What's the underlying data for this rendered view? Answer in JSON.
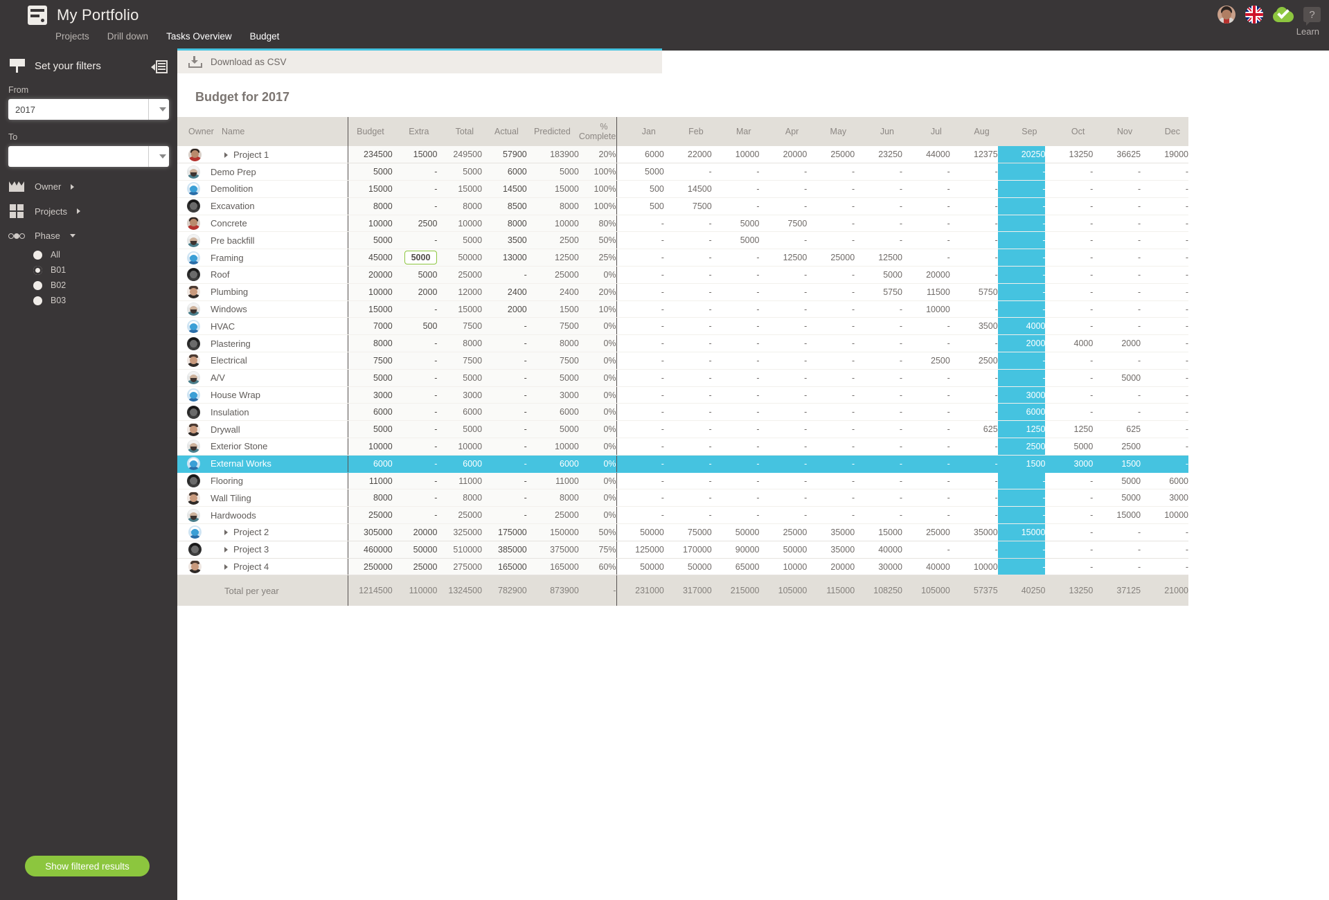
{
  "topbar": {
    "app_title": "My Portfolio",
    "nav": [
      {
        "label": "Projects",
        "active": false
      },
      {
        "label": "Drill down",
        "active": false
      },
      {
        "label": "Tasks Overview",
        "active": true
      },
      {
        "label": "Budget",
        "active": true
      }
    ],
    "learn_label": "Learn",
    "icons": [
      "user-avatar",
      "uk-flag-icon",
      "cloud-saved-icon",
      "help-icon"
    ]
  },
  "sidebar": {
    "title": "Set your filters",
    "from_label": "From",
    "from_value": "2017",
    "to_label": "To",
    "to_value": "",
    "groups": [
      {
        "label": "Owner",
        "icon": "crown-icon"
      },
      {
        "label": "Projects",
        "icon": "grid-icon"
      },
      {
        "label": "Phase",
        "icon": "phase-icon"
      }
    ],
    "phase_options": [
      {
        "label": "All",
        "selected": false
      },
      {
        "label": "B01",
        "selected": true
      },
      {
        "label": "B02",
        "selected": false
      },
      {
        "label": "B03",
        "selected": false
      }
    ],
    "show_button": "Show filtered results"
  },
  "main": {
    "csv_label": "Download as CSV",
    "page_title": "Budget for 2017",
    "headers": {
      "owner": "Owner",
      "name": "Name",
      "budget": "Budget",
      "extra": "Extra",
      "total": "Total",
      "actual": "Actual",
      "predicted": "Predicted",
      "percent_complete": "% Complete",
      "months": [
        "Jan",
        "Feb",
        "Mar",
        "Apr",
        "May",
        "Jun",
        "Jul",
        "Aug",
        "Sep",
        "Oct",
        "Nov",
        "Dec"
      ]
    },
    "highlight_month": "Sep",
    "highlight_color": "#45c3e0",
    "rows": [
      {
        "name": "Project 1",
        "type": "project",
        "expanded": true,
        "avatar": "a",
        "budget": "234500",
        "extra": "15000",
        "total": "249500",
        "actual": "57900",
        "predicted": "183900",
        "pct": "20%",
        "months": [
          "6000",
          "22000",
          "10000",
          "20000",
          "25000",
          "23250",
          "44000",
          "12375",
          "20250",
          "13250",
          "36625",
          "19000"
        ]
      },
      {
        "name": "Demo Prep",
        "type": "task",
        "avatar": "b",
        "budget": "5000",
        "extra": "-",
        "total": "5000",
        "actual": "6000",
        "predicted": "5000",
        "pct": "100%",
        "months": [
          "5000",
          "-",
          "-",
          "-",
          "-",
          "-",
          "-",
          "-",
          "-",
          "-",
          "-",
          "-"
        ]
      },
      {
        "name": "Demolition",
        "type": "task",
        "avatar": "c",
        "budget": "15000",
        "extra": "-",
        "total": "15000",
        "actual": "14500",
        "predicted": "15000",
        "pct": "100%",
        "months": [
          "500",
          "14500",
          "-",
          "-",
          "-",
          "-",
          "-",
          "-",
          "-",
          "-",
          "-",
          "-"
        ]
      },
      {
        "name": "Excavation",
        "type": "task",
        "avatar": "d",
        "budget": "8000",
        "extra": "-",
        "total": "8000",
        "actual": "8500",
        "predicted": "8000",
        "pct": "100%",
        "months": [
          "500",
          "7500",
          "-",
          "-",
          "-",
          "-",
          "-",
          "-",
          "-",
          "-",
          "-",
          "-"
        ]
      },
      {
        "name": "Concrete",
        "type": "task",
        "avatar": "a",
        "budget": "10000",
        "extra": "2500",
        "total": "10000",
        "actual": "8000",
        "predicted": "10000",
        "pct": "80%",
        "months": [
          "-",
          "-",
          "5000",
          "7500",
          "-",
          "-",
          "-",
          "-",
          "-",
          "-",
          "-",
          "-"
        ]
      },
      {
        "name": "Pre backfill",
        "type": "task",
        "avatar": "b",
        "budget": "5000",
        "extra": "-",
        "total": "5000",
        "actual": "3500",
        "predicted": "2500",
        "pct": "50%",
        "months": [
          "-",
          "-",
          "5000",
          "-",
          "-",
          "-",
          "-",
          "-",
          "-",
          "-",
          "-",
          "-"
        ]
      },
      {
        "name": "Framing",
        "type": "task",
        "avatar": "c",
        "budget": "45000",
        "extra": "5000",
        "extra_editing": true,
        "total": "50000",
        "actual": "13000",
        "predicted": "12500",
        "pct": "25%",
        "months": [
          "-",
          "-",
          "-",
          "12500",
          "25000",
          "12500",
          "-",
          "-",
          "-",
          "-",
          "-",
          "-"
        ]
      },
      {
        "name": "Roof",
        "type": "task",
        "avatar": "d",
        "budget": "20000",
        "extra": "5000",
        "total": "25000",
        "actual": "-",
        "predicted": "25000",
        "pct": "0%",
        "months": [
          "-",
          "-",
          "-",
          "-",
          "-",
          "5000",
          "20000",
          "-",
          "-",
          "-",
          "-",
          "-"
        ]
      },
      {
        "name": "Plumbing",
        "type": "task",
        "avatar": "e",
        "budget": "10000",
        "extra": "2000",
        "total": "12000",
        "actual": "2400",
        "predicted": "2400",
        "pct": "20%",
        "months": [
          "-",
          "-",
          "-",
          "-",
          "-",
          "5750",
          "11500",
          "5750",
          "-",
          "-",
          "-",
          "-"
        ]
      },
      {
        "name": "Windows",
        "type": "task",
        "avatar": "b",
        "budget": "15000",
        "extra": "-",
        "total": "15000",
        "actual": "2000",
        "predicted": "1500",
        "pct": "10%",
        "months": [
          "-",
          "-",
          "-",
          "-",
          "-",
          "-",
          "10000",
          "-",
          "-",
          "-",
          "-",
          "-"
        ]
      },
      {
        "name": "HVAC",
        "type": "task",
        "avatar": "c",
        "budget": "7000",
        "extra": "500",
        "total": "7500",
        "actual": "-",
        "predicted": "7500",
        "pct": "0%",
        "months": [
          "-",
          "-",
          "-",
          "-",
          "-",
          "-",
          "-",
          "3500",
          "4000",
          "-",
          "-",
          "-"
        ]
      },
      {
        "name": "Plastering",
        "type": "task",
        "avatar": "d",
        "budget": "8000",
        "extra": "-",
        "total": "8000",
        "actual": "-",
        "predicted": "8000",
        "pct": "0%",
        "months": [
          "-",
          "-",
          "-",
          "-",
          "-",
          "-",
          "-",
          "-",
          "2000",
          "4000",
          "2000",
          "-"
        ]
      },
      {
        "name": "Electrical",
        "type": "task",
        "avatar": "e",
        "budget": "7500",
        "extra": "-",
        "total": "7500",
        "actual": "-",
        "predicted": "7500",
        "pct": "0%",
        "months": [
          "-",
          "-",
          "-",
          "-",
          "-",
          "-",
          "2500",
          "2500",
          "-",
          "-",
          "-",
          "-"
        ]
      },
      {
        "name": "A/V",
        "type": "task",
        "avatar": "b",
        "budget": "5000",
        "extra": "-",
        "total": "5000",
        "actual": "-",
        "predicted": "5000",
        "pct": "0%",
        "months": [
          "-",
          "-",
          "-",
          "-",
          "-",
          "-",
          "-",
          "-",
          "-",
          "-",
          "5000",
          "-"
        ]
      },
      {
        "name": "House Wrap",
        "type": "task",
        "avatar": "c",
        "budget": "3000",
        "extra": "-",
        "total": "3000",
        "actual": "-",
        "predicted": "3000",
        "pct": "0%",
        "months": [
          "-",
          "-",
          "-",
          "-",
          "-",
          "-",
          "-",
          "-",
          "3000",
          "-",
          "-",
          "-"
        ]
      },
      {
        "name": "Insulation",
        "type": "task",
        "avatar": "d",
        "budget": "6000",
        "extra": "-",
        "total": "6000",
        "actual": "-",
        "predicted": "6000",
        "pct": "0%",
        "months": [
          "-",
          "-",
          "-",
          "-",
          "-",
          "-",
          "-",
          "-",
          "6000",
          "-",
          "-",
          "-"
        ]
      },
      {
        "name": "Drywall",
        "type": "task",
        "avatar": "e",
        "budget": "5000",
        "extra": "-",
        "total": "5000",
        "actual": "-",
        "predicted": "5000",
        "pct": "0%",
        "months": [
          "-",
          "-",
          "-",
          "-",
          "-",
          "-",
          "-",
          "625",
          "1250",
          "1250",
          "625",
          "-"
        ]
      },
      {
        "name": "Exterior Stone",
        "type": "task",
        "avatar": "b",
        "budget": "10000",
        "extra": "-",
        "total": "10000",
        "actual": "-",
        "predicted": "10000",
        "pct": "0%",
        "months": [
          "-",
          "-",
          "-",
          "-",
          "-",
          "-",
          "-",
          "-",
          "2500",
          "5000",
          "2500",
          "-"
        ]
      },
      {
        "name": "External Works",
        "type": "task",
        "avatar": "c",
        "selected": true,
        "budget": "6000",
        "extra": "-",
        "total": "6000",
        "actual": "-",
        "predicted": "6000",
        "pct": "0%",
        "months": [
          "-",
          "-",
          "-",
          "-",
          "-",
          "-",
          "-",
          "-",
          "1500",
          "3000",
          "1500",
          "-"
        ]
      },
      {
        "name": "Flooring",
        "type": "task",
        "avatar": "d",
        "budget": "11000",
        "extra": "-",
        "total": "11000",
        "actual": "-",
        "predicted": "11000",
        "pct": "0%",
        "months": [
          "-",
          "-",
          "-",
          "-",
          "-",
          "-",
          "-",
          "-",
          "-",
          "-",
          "5000",
          "6000"
        ]
      },
      {
        "name": "Wall Tiling",
        "type": "task",
        "avatar": "e",
        "budget": "8000",
        "extra": "-",
        "total": "8000",
        "actual": "-",
        "predicted": "8000",
        "pct": "0%",
        "months": [
          "-",
          "-",
          "-",
          "-",
          "-",
          "-",
          "-",
          "-",
          "-",
          "-",
          "5000",
          "3000"
        ]
      },
      {
        "name": "Hardwoods",
        "type": "task",
        "avatar": "b",
        "budget": "25000",
        "extra": "-",
        "total": "25000",
        "actual": "-",
        "predicted": "25000",
        "pct": "0%",
        "months": [
          "-",
          "-",
          "-",
          "-",
          "-",
          "-",
          "-",
          "-",
          "-",
          "-",
          "15000",
          "10000"
        ]
      },
      {
        "name": "Project 2",
        "type": "project",
        "expanded": false,
        "avatar": "c",
        "budget": "305000",
        "extra": "20000",
        "total": "325000",
        "actual": "175000",
        "predicted": "150000",
        "pct": "50%",
        "months": [
          "50000",
          "75000",
          "50000",
          "25000",
          "35000",
          "15000",
          "25000",
          "35000",
          "15000",
          "-",
          "-",
          "-"
        ]
      },
      {
        "name": "Project 3",
        "type": "project",
        "expanded": false,
        "avatar": "d",
        "budget": "460000",
        "extra": "50000",
        "total": "510000",
        "actual": "385000",
        "predicted": "375000",
        "pct": "75%",
        "months": [
          "125000",
          "170000",
          "90000",
          "50000",
          "35000",
          "40000",
          "-",
          "-",
          "-",
          "-",
          "-",
          "-"
        ]
      },
      {
        "name": "Project 4",
        "type": "project",
        "expanded": false,
        "avatar": "e",
        "budget": "250000",
        "extra": "25000",
        "total": "275000",
        "actual": "165000",
        "predicted": "165000",
        "pct": "60%",
        "months": [
          "50000",
          "50000",
          "65000",
          "10000",
          "20000",
          "30000",
          "40000",
          "10000",
          "-",
          "-",
          "-",
          "-"
        ]
      }
    ],
    "total_row": {
      "label": "Total per year",
      "budget": "1214500",
      "extra": "110000",
      "total": "1324500",
      "actual": "782900",
      "predicted": "873900",
      "pct": "-",
      "months": [
        "231000",
        "317000",
        "215000",
        "105000",
        "115000",
        "108250",
        "105000",
        "57375",
        "40250",
        "13250",
        "37125",
        "21000"
      ]
    }
  }
}
